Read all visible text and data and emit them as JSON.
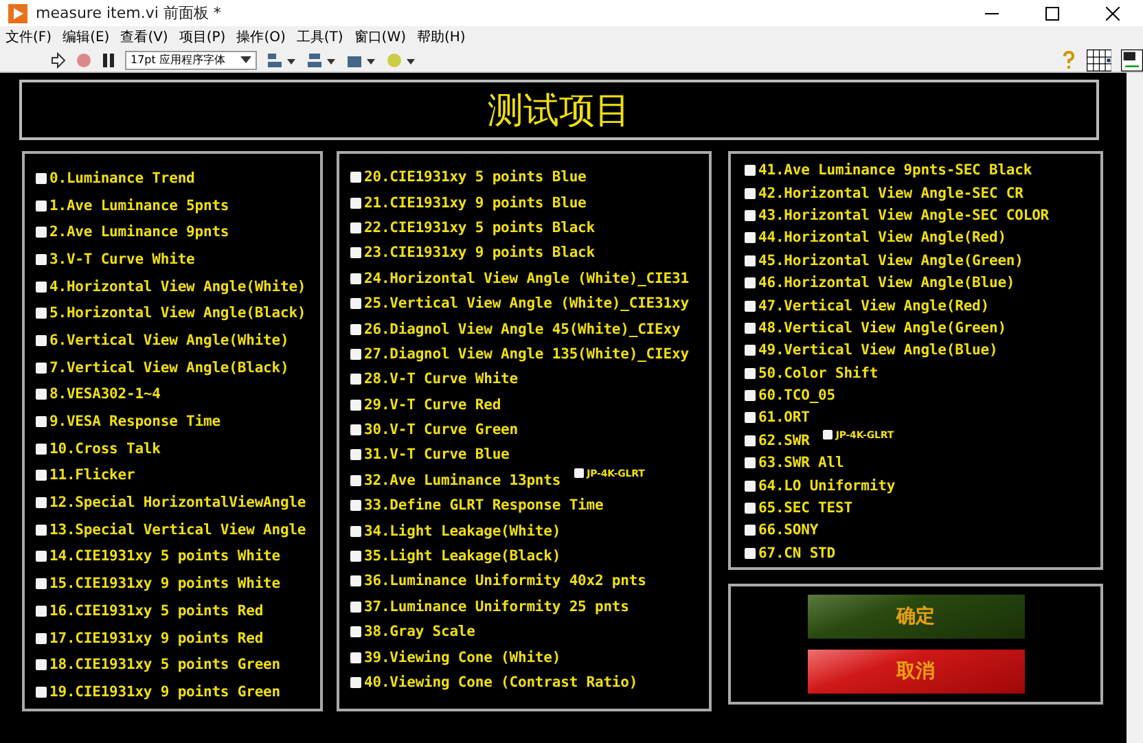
{
  "window": {
    "title": "measure item.vi 前面板 *"
  },
  "menu": [
    "文件(F)",
    "编辑(E)",
    "查看(V)",
    "项目(P)",
    "操作(O)",
    "工具(T)",
    "窗口(W)",
    "帮助(H)"
  ],
  "toolbar": {
    "font": "17pt 应用程序字体"
  },
  "heading": "测试项目",
  "columns": [
    [
      {
        "label": "0.Luminance Trend",
        "checked": false
      },
      {
        "label": "1.Ave Luminance 5pnts",
        "checked": false
      },
      {
        "label": "2.Ave Luminance 9pnts",
        "checked": false
      },
      {
        "label": "3.V-T Curve White",
        "checked": false
      },
      {
        "label": "4.Horizontal View Angle(White)",
        "checked": false
      },
      {
        "label": "5.Horizontal View Angle(Black)",
        "checked": false
      },
      {
        "label": "6.Vertical View Angle(White)",
        "checked": false
      },
      {
        "label": "7.Vertical View Angle(Black)",
        "checked": false
      },
      {
        "label": "8.VESA302-1~4",
        "checked": false
      },
      {
        "label": "9.VESA Response Time",
        "checked": false
      },
      {
        "label": "10.Cross Talk",
        "checked": false
      },
      {
        "label": "11.Flicker",
        "checked": false
      },
      {
        "label": "12.Special HorizontalViewAngle",
        "checked": false
      },
      {
        "label": "13.Special Vertical View Angle",
        "checked": false
      },
      {
        "label": "14.CIE1931xy 5 points White",
        "checked": false
      },
      {
        "label": "15.CIE1931xy 9 points White",
        "checked": false
      },
      {
        "label": "16.CIE1931xy 5 points Red",
        "checked": false
      },
      {
        "label": "17.CIE1931xy 9 points Red",
        "checked": false
      },
      {
        "label": "18.CIE1931xy 5 points Green",
        "checked": false
      },
      {
        "label": "19.CIE1931xy 9 points Green",
        "checked": false
      }
    ],
    [
      {
        "label": "20.CIE1931xy 5 points Blue",
        "checked": false
      },
      {
        "label": "21.CIE1931xy 9 points Blue",
        "checked": false
      },
      {
        "label": "22.CIE1931xy 5 points Black",
        "checked": false
      },
      {
        "label": "23.CIE1931xy 9 points Black",
        "checked": false
      },
      {
        "label": "24.Horizontal View Angle (White)_CIE31",
        "checked": false
      },
      {
        "label": "25.Vertical View Angle (White)_CIE31xy",
        "checked": false
      },
      {
        "label": "26.Diagnol View Angle 45(White)_CIExy",
        "checked": false
      },
      {
        "label": "27.Diagnol View Angle 135(White)_CIExy",
        "checked": false
      },
      {
        "label": "28.V-T Curve White",
        "checked": false
      },
      {
        "label": "29.V-T Curve Red",
        "checked": false
      },
      {
        "label": "30.V-T Curve Green",
        "checked": false
      },
      {
        "label": "31.V-T Curve Blue",
        "checked": false
      },
      {
        "label": "32.Ave Luminance 13pnts",
        "checked": false,
        "extra": {
          "label": "JP-4K-GLRT",
          "checked": false
        }
      },
      {
        "label": "33.Define GLRT Response Time",
        "checked": false
      },
      {
        "label": "34.Light Leakage(White)",
        "checked": false
      },
      {
        "label": "35.Light Leakage(Black)",
        "checked": false
      },
      {
        "label": "36.Luminance Uniformity 40x2 pnts",
        "checked": false
      },
      {
        "label": "37.Luminance Uniformity 25 pnts",
        "checked": false
      },
      {
        "label": "38.Gray Scale",
        "checked": false
      },
      {
        "label": "39.Viewing Cone (White)",
        "checked": false
      },
      {
        "label": "40.Viewing Cone (Contrast Ratio)",
        "checked": false
      }
    ],
    [
      {
        "label": "41.Ave Luminance 9pnts-SEC Black",
        "checked": false
      },
      {
        "label": "42.Horizontal View Angle-SEC CR",
        "checked": false
      },
      {
        "label": "43.Horizontal View Angle-SEC COLOR",
        "checked": false
      },
      {
        "label": "44.Horizontal View Angle(Red)",
        "checked": false
      },
      {
        "label": "45.Horizontal View Angle(Green)",
        "checked": false
      },
      {
        "label": "46.Horizontal View Angle(Blue)",
        "checked": false
      },
      {
        "label": "47.Vertical View Angle(Red)",
        "checked": false
      },
      {
        "label": "48.Vertical View Angle(Green)",
        "checked": false
      },
      {
        "label": "49.Vertical View Angle(Blue)",
        "checked": false
      },
      {
        "label": "50.Color Shift",
        "checked": false
      },
      {
        "label": "60.TCO_05",
        "checked": false
      },
      {
        "label": "61.ORT",
        "checked": false
      },
      {
        "label": "62.SWR",
        "checked": false,
        "extra": {
          "label": "JP-4K-GLRT",
          "checked": false
        }
      },
      {
        "label": "63.SWR All",
        "checked": false
      },
      {
        "label": "64.LO Uniformity",
        "checked": false
      },
      {
        "label": "65.SEC TEST",
        "checked": false
      },
      {
        "label": "66.SONY",
        "checked": false
      },
      {
        "label": "67.CN STD",
        "checked": false
      }
    ]
  ],
  "buttons": [
    {
      "label": "确定",
      "kind": "confirm"
    },
    {
      "label": "取消",
      "kind": "cancel"
    }
  ]
}
